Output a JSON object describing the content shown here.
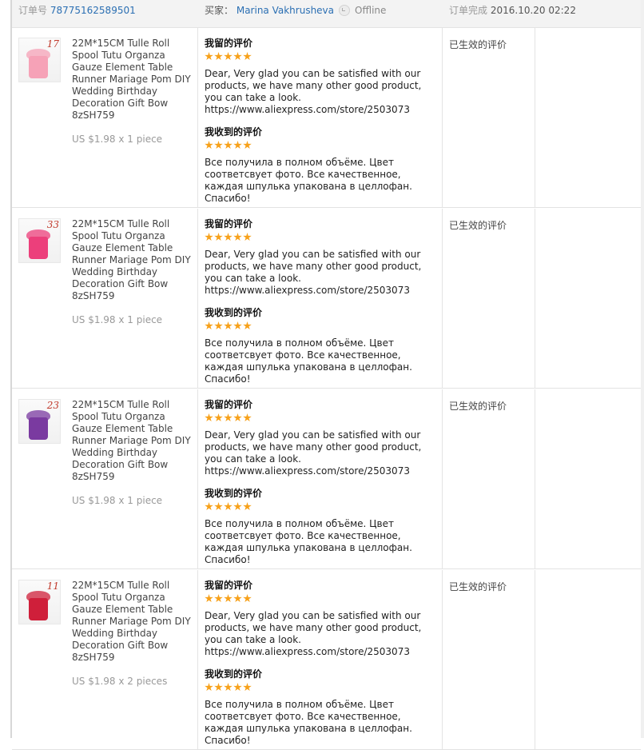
{
  "header": {
    "order_label": "订单号",
    "order_number": "78775162589501",
    "buyer_label": "买家：",
    "buyer_name": "Marina Vakhrusheva",
    "buyer_status": "Offline",
    "complete_label": "订单完成",
    "complete_time": "2016.10.20 02:22"
  },
  "colors": {
    "star": "#f7a11a",
    "link": "#2b6fb3",
    "thumb_number": "#c0392b"
  },
  "items": [
    {
      "thumb_number": "17",
      "thumb_color": "#f6a2b7",
      "title": "22M*15CM Tulle Roll Spool Tutu Organza Gauze Element Table Runner Mariage Pom DIY Wedding Birthday Decoration Gift Bow 8zSH759",
      "price": "US $1.98 x 1 piece",
      "my_review_label": "我留的评价",
      "my_rating": 5,
      "my_review": "Dear, Very glad you can be satisfied with our products, we have many other good product, you can take a look.\nhttps://www.aliexpress.com/store/2503073",
      "received_review_label": "我收到的评价",
      "received_rating": 5,
      "received_review": "Все получила в полном объёме. Цвет соответсвует фото. Все качественное, каждая шпулька упакована в целлофан. Спасибо!",
      "status": "已生效的评价"
    },
    {
      "thumb_number": "33",
      "thumb_color": "#ec3f7b",
      "title": "22M*15CM Tulle Roll Spool Tutu Organza Gauze Element Table Runner Mariage Pom DIY Wedding Birthday Decoration Gift Bow 8zSH759",
      "price": "US $1.98 x 1 piece",
      "my_review_label": "我留的评价",
      "my_rating": 5,
      "my_review": "Dear, Very glad you can be satisfied with our products, we have many other good product, you can take a look.\nhttps://www.aliexpress.com/store/2503073",
      "received_review_label": "我收到的评价",
      "received_rating": 5,
      "received_review": "Все получила в полном объёме. Цвет соответсвует фото. Все качественное, каждая шпулька упакована в целлофан. Спасибо!",
      "status": "已生效的评价"
    },
    {
      "thumb_number": "23",
      "thumb_color": "#7a3aa0",
      "title": "22M*15CM Tulle Roll Spool Tutu Organza Gauze Element Table Runner Mariage Pom DIY Wedding Birthday Decoration Gift Bow 8zSH759",
      "price": "US $1.98 x 1 piece",
      "my_review_label": "我留的评价",
      "my_rating": 5,
      "my_review": "Dear, Very glad you can be satisfied with our products, we have many other good product, you can take a look.\nhttps://www.aliexpress.com/store/2503073",
      "received_review_label": "我收到的评价",
      "received_rating": 5,
      "received_review": "Все получила в полном объёме. Цвет соответсвует фото. Все качественное, каждая шпулька упакована в целлофан. Спасибо!",
      "status": "已生效的评价"
    },
    {
      "thumb_number": "11",
      "thumb_color": "#cf1f3a",
      "title": "22M*15CM Tulle Roll Spool Tutu Organza Gauze Element Table Runner Mariage Pom DIY Wedding Birthday Decoration Gift Bow 8zSH759",
      "price": "US $1.98 x 2 pieces",
      "my_review_label": "我留的评价",
      "my_rating": 5,
      "my_review": "Dear, Very glad you can be satisfied with our products, we have many other good product, you can take a look.\nhttps://www.aliexpress.com/store/2503073",
      "received_review_label": "我收到的评价",
      "received_rating": 5,
      "received_review": "Все получила в полном объёме. Цвет соответсвует фото. Все качественное, каждая шпулька упакована в целлофан. Спасибо!",
      "status": "已生效的评价"
    }
  ]
}
